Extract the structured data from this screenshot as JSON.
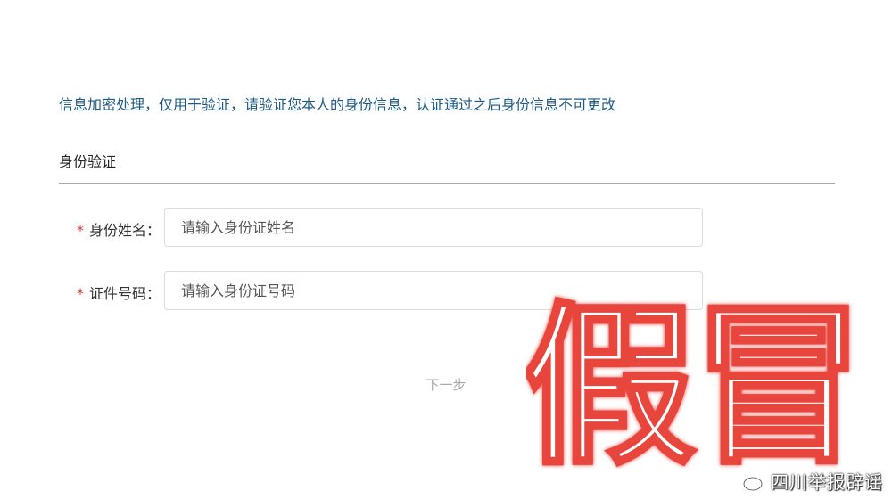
{
  "notice": "信息加密处理，仅用于验证，请验证您本人的身份信息，认证通过之后身份信息不可更改",
  "section": {
    "title": "身份验证"
  },
  "form": {
    "required_mark": "*",
    "name_field": {
      "label": "身份姓名：",
      "placeholder": "请输入身份证姓名",
      "value": ""
    },
    "id_field": {
      "label": "证件号码：",
      "placeholder": "请输入身份证号码",
      "value": ""
    },
    "next_label": "下一步"
  },
  "stamp": {
    "text": "假冒",
    "color": "#e8453c"
  },
  "watermark": {
    "account": "四川举报辟谣",
    "icon": "weibo-icon"
  }
}
